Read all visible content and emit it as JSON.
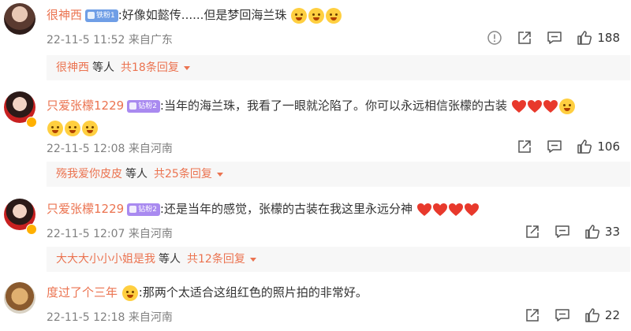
{
  "comments": [
    {
      "name": "很神西",
      "badge": "铁粉1",
      "text": ":好像如懿传......但是梦回海兰珠",
      "time": "22-11-5 11:52",
      "source": "来自广东",
      "likes": "188",
      "replies": {
        "name": "很神西",
        "suffix": "等人",
        "count": "共18条回复"
      }
    },
    {
      "name": "只爱张檬1229",
      "badge": "钻粉2",
      "text": ":当年的海兰珠，我看了一眼就沦陷了。你可以永远相信张檬的古装",
      "time": "22-11-5 12:08",
      "source": "来自河南",
      "likes": "106",
      "replies": {
        "name": "殇我爱你皮皮",
        "suffix": "等人",
        "count": "共25条回复"
      }
    },
    {
      "name": "只爱张檬1229",
      "badge": "钻粉2",
      "text": ":还是当年的感觉，张檬的古装在我这里永远分神",
      "time": "22-11-5 12:07",
      "source": "来自河南",
      "likes": "33",
      "replies": {
        "name": "大大大小小小姐是我",
        "suffix": "等人",
        "count": "共12条回复"
      }
    },
    {
      "name": "度过了个三年",
      "text": ":那两个太适合这组红色的照片拍的非常好。",
      "time": "22-11-5 12:18",
      "source": "来自河南",
      "likes": "22"
    }
  ],
  "icons": {
    "report": "exclamation-circle-icon",
    "share": "share-icon",
    "comment": "comment-icon",
    "like": "thumbs-up-icon",
    "badge_verified": "verified-badge-icon",
    "emoji_cry": "crying-emoji",
    "emoji_think": "thinking-emoji",
    "emoji_heart": "red-heart-emoji"
  },
  "colors": {
    "username": "#eb7350",
    "meta": "#808080",
    "reply_bg": "#f7f7f7",
    "heart": "#e8392c"
  }
}
